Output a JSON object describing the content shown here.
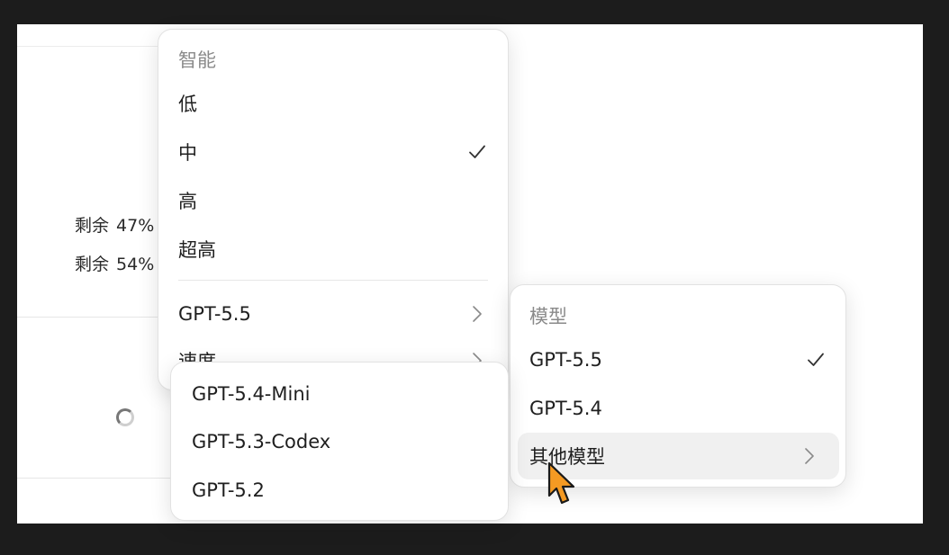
{
  "background": {
    "usage_rows": [
      {
        "label": "剩余",
        "value": "47%"
      },
      {
        "label": "剩余",
        "value": "54%"
      }
    ]
  },
  "main_menu": {
    "header": "智能",
    "items": [
      {
        "label": "低",
        "checked": false
      },
      {
        "label": "中",
        "checked": true
      },
      {
        "label": "高",
        "checked": false
      },
      {
        "label": "超高",
        "checked": false
      }
    ],
    "model_item": "GPT-5.5",
    "speed_item": "速度"
  },
  "models_menu": {
    "header": "模型",
    "items": [
      {
        "label": "GPT-5.5",
        "checked": true
      },
      {
        "label": "GPT-5.4",
        "checked": false
      }
    ],
    "other_item": "其他模型"
  },
  "other_menu": {
    "items": [
      {
        "label": "GPT-5.4-Mini"
      },
      {
        "label": "GPT-5.3-Codex"
      },
      {
        "label": "GPT-5.2"
      }
    ]
  },
  "colors": {
    "cursor_fill": "#f59a23",
    "hover_bg": "#f0f0f0"
  },
  "icons": {
    "check": "checkmark-icon",
    "chevron": "chevron-right-icon",
    "cursor": "mouse-pointer-icon"
  }
}
